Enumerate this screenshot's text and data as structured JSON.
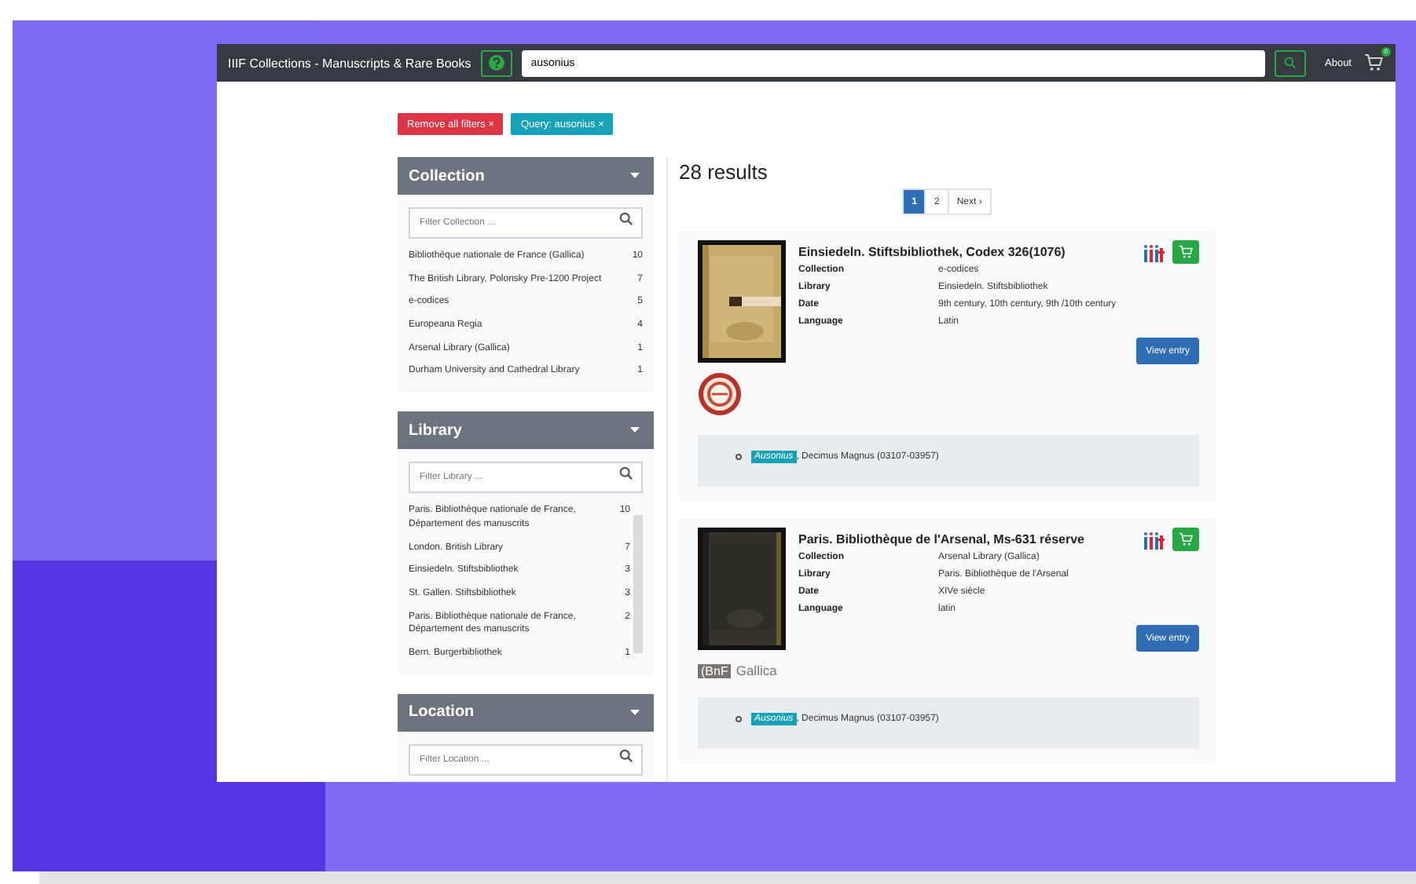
{
  "navbar": {
    "title": "IIIF Collections - Manuscripts & Rare Books",
    "search": {
      "value": "ausonius"
    },
    "about": "About",
    "cart_count": "0"
  },
  "filters": [
    {
      "label": "Remove all filters",
      "kind": "danger",
      "close": "×"
    },
    {
      "label": "Query: ausonius",
      "kind": "info",
      "close": "×"
    }
  ],
  "facets": [
    {
      "title": "Collection",
      "placeholder": "Filter Collection ...",
      "items": [
        {
          "label": "Bibliothèque nationale de France (Gallica)",
          "count": "10"
        },
        {
          "label": "The British Library, Polonsky Pre-1200 Project",
          "count": "7"
        },
        {
          "label": "e-codices",
          "count": "5"
        },
        {
          "label": "Europeana Regia",
          "count": "4"
        },
        {
          "label": "Arsenal Library (Gallica)",
          "count": "1"
        },
        {
          "label": "Durham University and Cathedral Library",
          "count": "1"
        }
      ]
    },
    {
      "title": "Library",
      "placeholder": "Filter Library ...",
      "scrollable": true,
      "items": [
        {
          "label": "Paris. Bibliothèque nationale de France, Département des manuscrits",
          "count": "10"
        },
        {
          "label": "London. British Library",
          "count": "7"
        },
        {
          "label": "Einsiedeln. Stiftsbibliothek",
          "count": "3"
        },
        {
          "label": "St. Gallen. Stiftsbibliothek",
          "count": "3"
        },
        {
          "label": "Paris. Bibliothèque nationale de France, Département des manuscrits",
          "count": "2"
        },
        {
          "label": "Bern. Burgerbibliothek",
          "count": "1"
        }
      ]
    },
    {
      "title": "Location",
      "placeholder": "Filter Location ..."
    }
  ],
  "results": {
    "heading": "28 results",
    "pages": [
      {
        "label": "1",
        "selected": true
      },
      {
        "label": "2",
        "selected": false
      },
      {
        "label": "Next ›",
        "selected": false
      }
    ],
    "items": [
      {
        "title": "Einsiedeln. Stiftsbibliothek, Codex 326(1076)",
        "fields": [
          {
            "label": "Collection",
            "value": "e-codices"
          },
          {
            "label": "Library",
            "value": "Einsiedeln. Stiftsbibliothek"
          },
          {
            "label": "Date",
            "value": "9th century, 10th century, 9th /10th century"
          },
          {
            "label": "Language",
            "value": "Latin"
          }
        ],
        "button": "View entry",
        "logo": {
          "kind": "seal"
        },
        "authors": [
          {
            "highlight": "Ausonius",
            "rest": ", Decimus Magnus (03107-03957)"
          }
        ]
      },
      {
        "title": "Paris. Bibliothèque de l'Arsenal, Ms-631 réserve",
        "fields": [
          {
            "label": "Collection",
            "value": "Arsenal Library (Gallica)"
          },
          {
            "label": "Library",
            "value": "Paris. Bibliothèque de l'Arsenal"
          },
          {
            "label": "Date",
            "value": "XIVe siècle"
          },
          {
            "label": "Language",
            "value": "latin"
          }
        ],
        "button": "View entry",
        "logo": {
          "kind": "wordmark",
          "mark": "(BnF",
          "name": "Gallica"
        },
        "authors": [
          {
            "highlight": "Ausonius",
            "rest": ", Decimus Magnus (03107-03957)"
          }
        ]
      }
    ]
  }
}
